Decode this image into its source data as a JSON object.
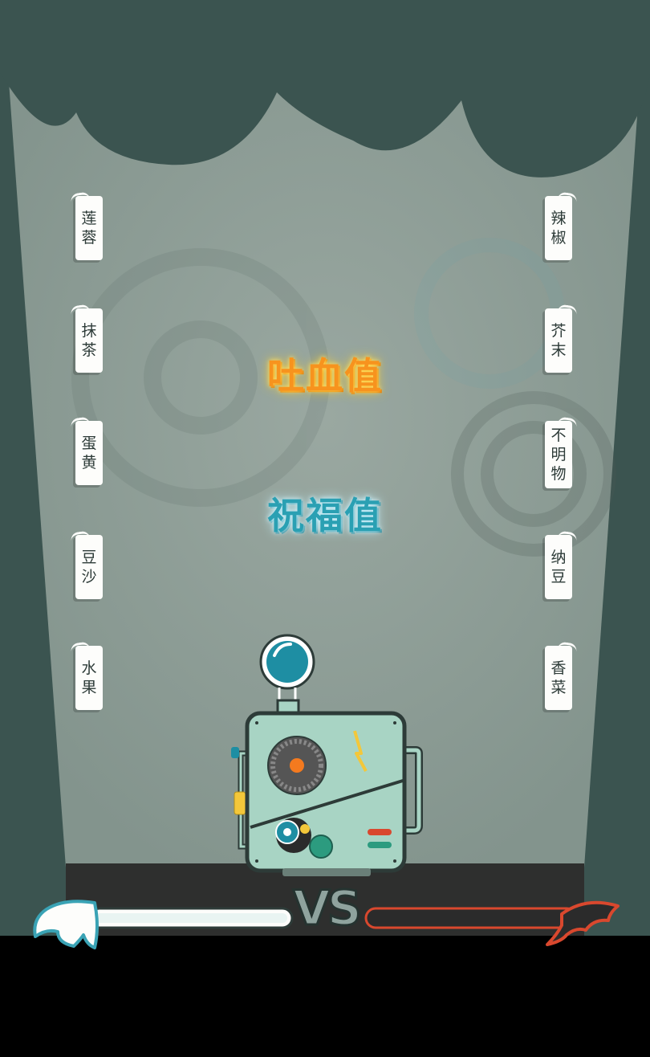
{
  "title_vomit": "吐血值",
  "title_blessing": "祝福值",
  "left_flavors": [
    {
      "name": "莲蓉",
      "chars": [
        "莲",
        "蓉"
      ]
    },
    {
      "name": "抹茶",
      "chars": [
        "抹",
        "茶"
      ]
    },
    {
      "name": "蛋黄",
      "chars": [
        "蛋",
        "黄"
      ]
    },
    {
      "name": "豆沙",
      "chars": [
        "豆",
        "沙"
      ]
    },
    {
      "name": "水果",
      "chars": [
        "水",
        "果"
      ]
    }
  ],
  "right_flavors": [
    {
      "name": "辣椒",
      "chars": [
        "辣",
        "椒"
      ]
    },
    {
      "name": "芥末",
      "chars": [
        "芥",
        "末"
      ]
    },
    {
      "name": "不明物",
      "chars": [
        "不",
        "明",
        "物"
      ]
    },
    {
      "name": "纳豆",
      "chars": [
        "纳",
        "豆"
      ]
    },
    {
      "name": "香菜",
      "chars": [
        "香",
        "菜"
      ]
    }
  ],
  "versus_label": "VS",
  "blessing_bar_progress": 0,
  "vomit_bar_progress": 0,
  "colors": {
    "curtain": "#3b5450",
    "stage_light": "#8a9a93",
    "vomit_orange": "#f7931e",
    "blessing_teal": "#2aa0b3",
    "devil_red": "#d9482e",
    "machine_body": "#a8d4c4"
  },
  "icons": {
    "angel": "angel-wing-icon",
    "devil": "devil-wing-icon",
    "machine": "mooncake-machine-icon",
    "gear": "gear-icon",
    "bolt": "lightning-icon"
  }
}
